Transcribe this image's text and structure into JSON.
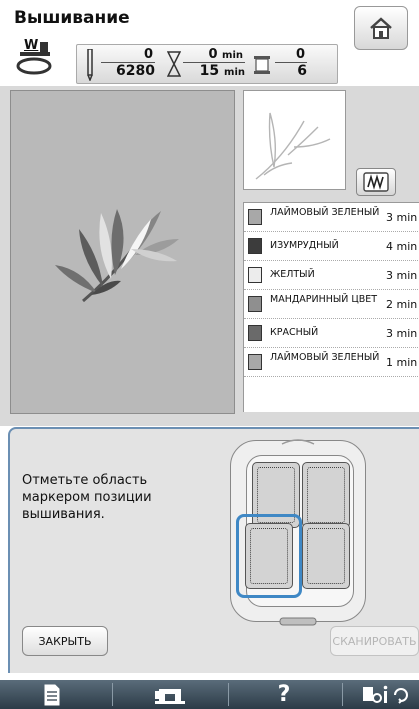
{
  "header": {
    "title": "Вышивание",
    "presser_foot_letter": "W"
  },
  "status": {
    "stitch_current": "0",
    "stitch_total": "6280",
    "time_current": "0",
    "time_current_unit": "min",
    "time_total": "15",
    "time_total_unit": "min",
    "color_current": "0",
    "color_total": "6"
  },
  "color_list": [
    {
      "name": "ЛАЙМОВЫЙ ЗЕЛЕНЫЙ",
      "time": "3 min",
      "color": "#a8a8a8"
    },
    {
      "name": "ИЗУМРУДНЫЙ",
      "time": "4 min",
      "color": "#3c3c3c"
    },
    {
      "name": "ЖЕЛТЫЙ",
      "time": "3 min",
      "color": "#ececec"
    },
    {
      "name": "МАНДАРИННЫЙ ЦВЕТ",
      "time": "2 min",
      "color": "#8f8f8f"
    },
    {
      "name": "КРАСНЫЙ",
      "time": "3 min",
      "color": "#6a6a6a"
    },
    {
      "name": "ЛАЙМОВЫЙ ЗЕЛЕНЫЙ",
      "time": "1 min",
      "color": "#a8a8a8"
    }
  ],
  "panel": {
    "instruction": "Отметьте область маркером позиции вышивания.",
    "selected_quadrant": "bottom-left"
  },
  "buttons": {
    "close": "ЗАКРЫТЬ",
    "scan": "СКАНИРОВАТЬ"
  },
  "bottom_bar": {
    "help_label": "?"
  },
  "colors": {
    "accent": "#3f88c5",
    "panel_border": "#6b8fb3",
    "bottom_bar": "#2c3b47"
  },
  "icons": [
    "home-icon",
    "presser-foot-icon",
    "needle-icon",
    "hourglass-icon",
    "spool-icon",
    "thread-cut-icon",
    "document-icon",
    "sewing-machine-icon",
    "help-icon",
    "settings-icon"
  ]
}
